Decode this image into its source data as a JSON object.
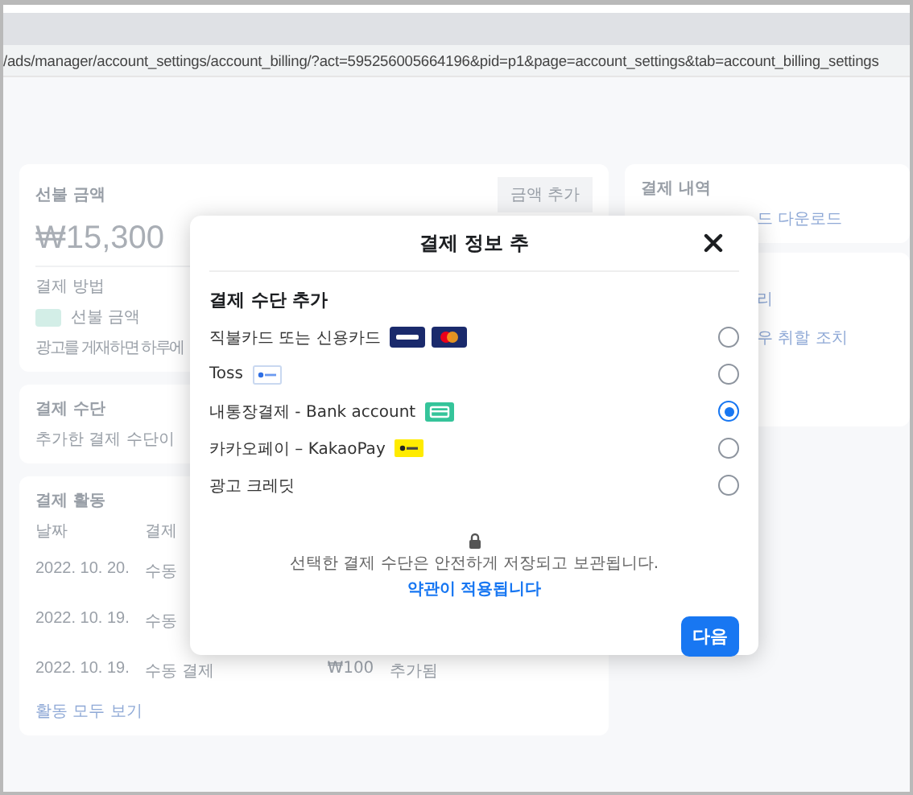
{
  "address_bar": {
    "url": "/ads/manager/account_settings/account_billing/?act=595256005664196&pid=p1&page=account_settings&tab=account_billing_settings"
  },
  "background": {
    "prepaid_card": {
      "title": "선불 금액",
      "amount": "₩15,300",
      "button": "금액 추가",
      "method_label": "결제 방법",
      "method_value": "선불 금액",
      "method_note": "광고를 게재하면 하루에"
    },
    "payment_method_card": {
      "title": "결제 수단",
      "note": "추가한 결제 수단이"
    },
    "activity_card": {
      "title": "결제 활동",
      "columns": [
        "날짜",
        "결제"
      ],
      "rows": [
        {
          "date": "2022. 10. 20.",
          "type": "수동"
        },
        {
          "date": "2022. 10. 19.",
          "type": "수동"
        },
        {
          "date": "2022. 10. 19.",
          "type": "수동 결제",
          "amount": "₩100",
          "status": "추가됨"
        }
      ],
      "link": "활동 모두 보기"
    },
    "history_card": {
      "title": "결제 내역",
      "link": "드 다운로드"
    },
    "side_card": {
      "lines": [
        "리",
        "우 취할 조치"
      ]
    }
  },
  "dialog": {
    "title": "결제 정보 추",
    "section": "결제 수단 추가",
    "options": [
      {
        "label": "직불카드 또는 신용카드",
        "kind": "cards",
        "selected": false
      },
      {
        "label": "Toss",
        "kind": "toss",
        "selected": false
      },
      {
        "label": "내통장결제 - Bank account",
        "kind": "bank",
        "selected": true
      },
      {
        "label": "카카오페이 – KakaoPay",
        "kind": "kakaopay",
        "selected": false
      },
      {
        "label": "광고 크레딧",
        "kind": "plain",
        "selected": false
      }
    ],
    "security_note": "선택한 결제 수단은 안전하게 저장되고 보관됩니다.",
    "terms_link": "약관이 적용됩니다",
    "next_button": "다음"
  }
}
